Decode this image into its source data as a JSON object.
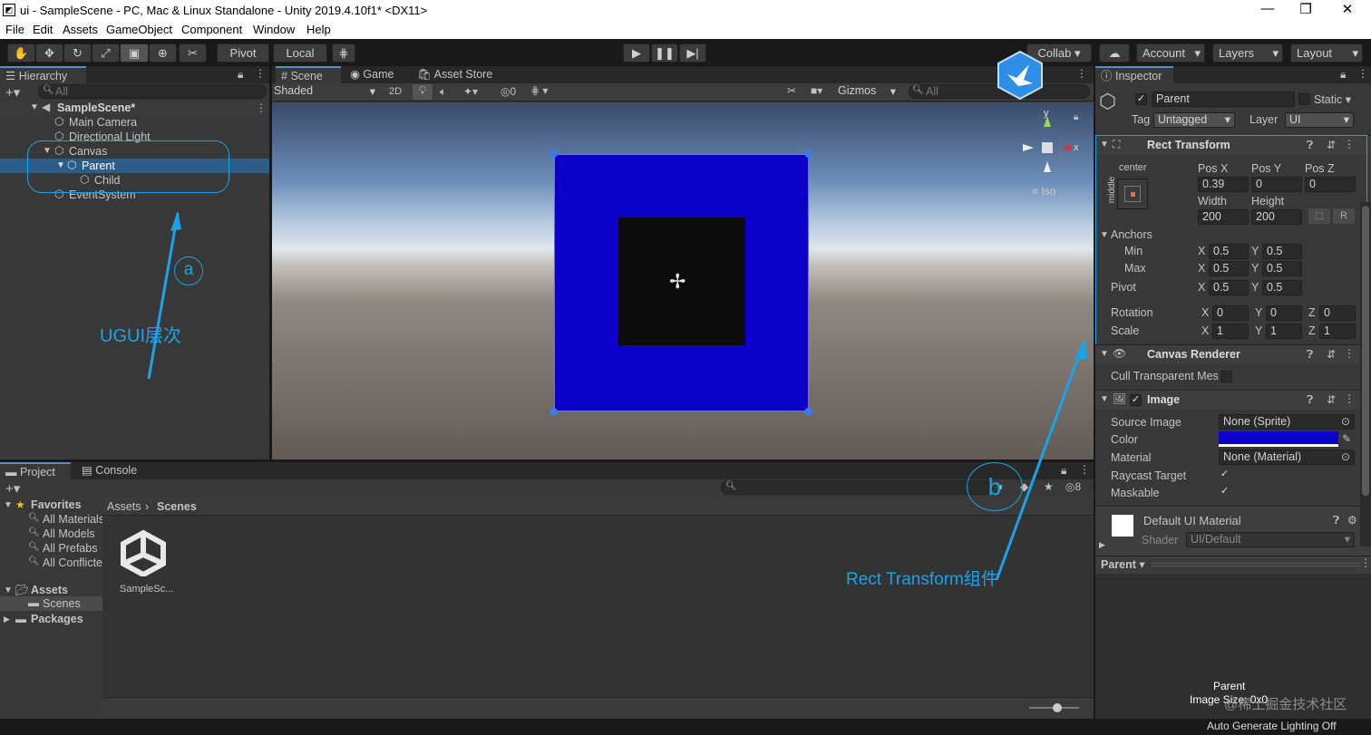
{
  "window": {
    "title": "ui - SampleScene - PC, Mac & Linux Standalone - Unity 2019.4.10f1* <DX11>",
    "app_icon": "unity-icon",
    "minimize": "—",
    "maximize": "❐",
    "close": "✕"
  },
  "menu": [
    "File",
    "Edit",
    "Assets",
    "GameObject",
    "Component",
    "Window",
    "Help"
  ],
  "toolbar": {
    "pivot": "Pivot",
    "local": "Local",
    "collab": "Collab",
    "account": "Account",
    "layers": "Layers",
    "layout": "Layout"
  },
  "hierarchy": {
    "tab": "Hierarchy",
    "search_placeholder": "All",
    "scene": "SampleScene*",
    "items": [
      "Main Camera",
      "Directional Light",
      "Canvas",
      "Parent",
      "Child",
      "EventSystem"
    ]
  },
  "scene_view": {
    "tabs": [
      "Scene",
      "Game",
      "Asset Store"
    ],
    "shading": "Shaded",
    "mode2d": "2D",
    "hidden_count": "0",
    "gizmos": "Gizmos",
    "search_placeholder": "All",
    "iso": "Iso",
    "axis_y": "y",
    "axis_x": "x",
    "parent_color": "#0a00c8",
    "child_color": "#0b0b0b"
  },
  "annotations": {
    "a": "a",
    "a_label": "UGUI层次",
    "b": "b",
    "b_label": "Rect Transform组件",
    "color": "#1aa3e8"
  },
  "inspector": {
    "tab": "Inspector",
    "object_name": "Parent",
    "static": "Static",
    "tag_label": "Tag",
    "tag": "Untagged",
    "layer_label": "Layer",
    "layer": "UI",
    "rect_transform": {
      "title": "Rect Transform",
      "anchor_preset": "center",
      "anchor_preset_side": "middle",
      "pos_x_label": "Pos X",
      "pos_y_label": "Pos Y",
      "pos_z_label": "Pos Z",
      "pos_x": "0.39",
      "pos_y": "0",
      "pos_z": "0",
      "width_label": "Width",
      "height_label": "Height",
      "width": "200",
      "height": "200",
      "anchors": "Anchors",
      "min": "Min",
      "max": "Max",
      "pivot": "Pivot",
      "min_x": "0.5",
      "min_y": "0.5",
      "max_x": "0.5",
      "max_y": "0.5",
      "pivot_x": "0.5",
      "pivot_y": "0.5",
      "rotation": "Rotation",
      "rot_x": "0",
      "rot_y": "0",
      "rot_z": "0",
      "scale": "Scale",
      "scale_x": "1",
      "scale_y": "1",
      "scale_z": "1",
      "x": "X",
      "y": "Y",
      "z": "Z",
      "r": "R"
    },
    "canvas_renderer": {
      "title": "Canvas Renderer",
      "cull": "Cull Transparent Mes"
    },
    "image": {
      "title": "Image",
      "source_image_label": "Source Image",
      "source_image": "None (Sprite)",
      "color_label": "Color",
      "color": "#0a00c8",
      "material_label": "Material",
      "material": "None (Material)",
      "raycast": "Raycast Target",
      "maskable": "Maskable"
    },
    "material": {
      "name": "Default UI Material",
      "shader_label": "Shader",
      "shader": "UI/Default"
    },
    "preview": {
      "label": "Parent",
      "name": "Parent",
      "image_size": "Image Size: 0x0"
    }
  },
  "project": {
    "tabs": [
      "Project",
      "Console"
    ],
    "hidden_count": "8",
    "favorites": "Favorites",
    "fav_items": [
      "All Materials",
      "All Models",
      "All Prefabs",
      "All Conflicte"
    ],
    "assets": "Assets",
    "scenes": "Scenes",
    "packages": "Packages",
    "breadcrumb": [
      "Assets",
      "Scenes"
    ],
    "file": "SampleSc..."
  },
  "status": {
    "lighting": "Auto Generate Lighting Off",
    "watermark": "@稀土掘金技术社区"
  }
}
